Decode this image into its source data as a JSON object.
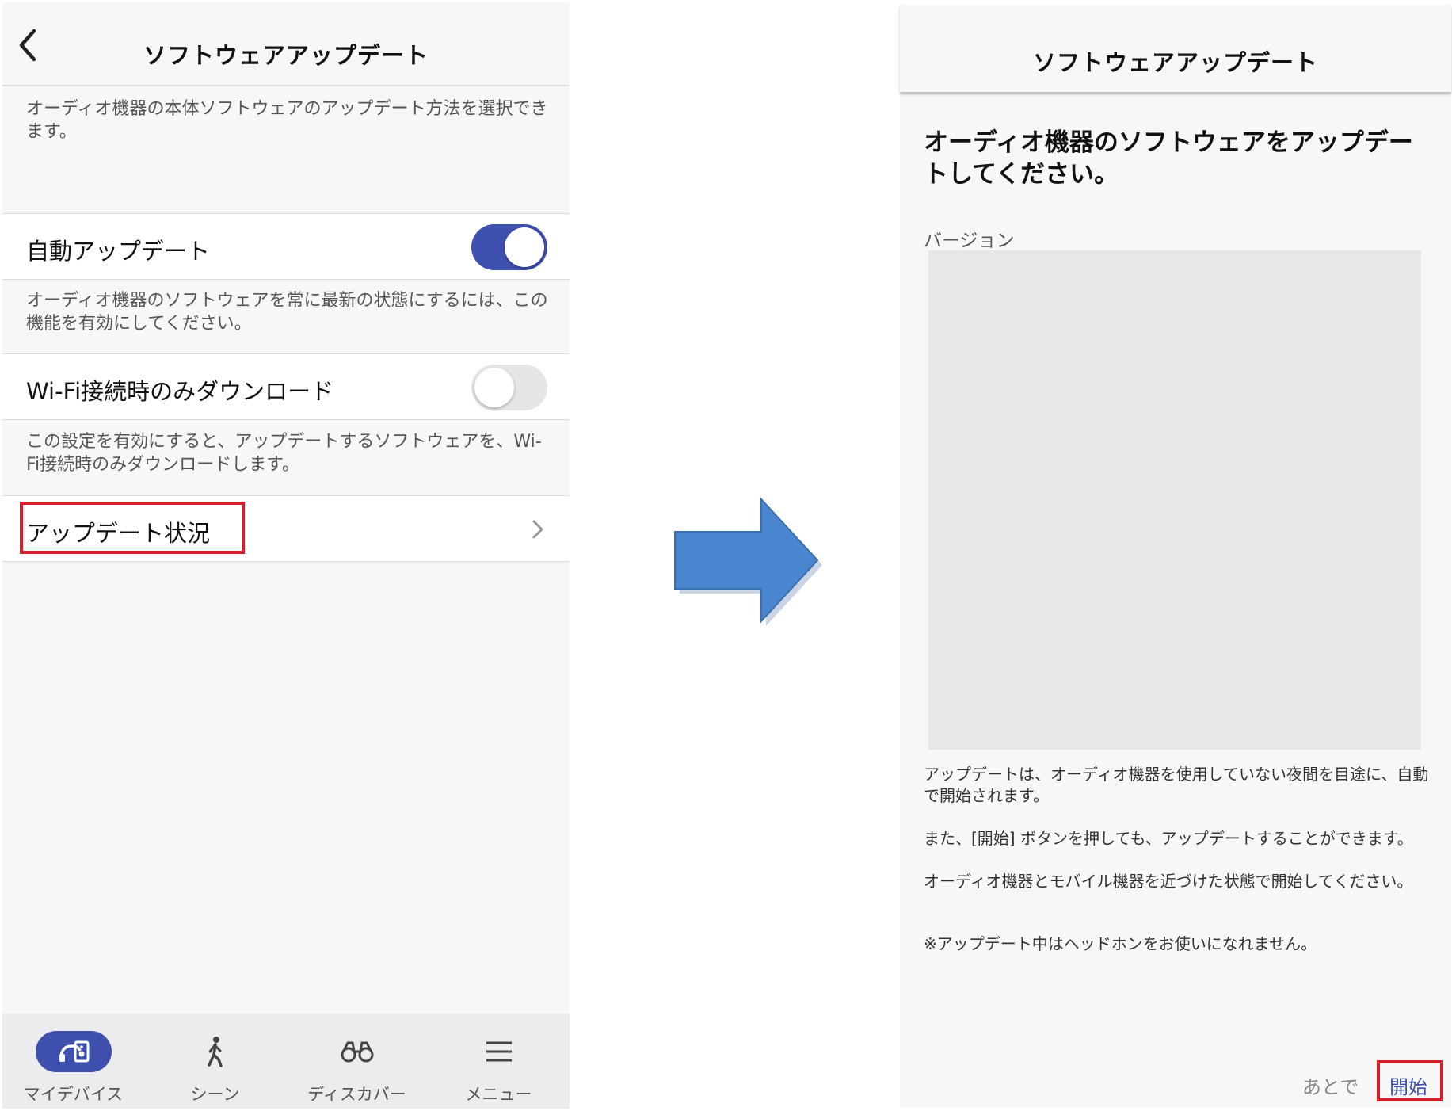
{
  "left": {
    "header": {
      "title": "ソフトウェアアップデート"
    },
    "intro": "オーディオ機器の本体ソフトウェアのアップデート方法を選択できます。",
    "auto_update": {
      "label": "自動アップデート",
      "enabled": true,
      "description": "オーディオ機器のソフトウェアを常に最新の状態にするには、この機能を有効にしてください。"
    },
    "wifi_only": {
      "label": "Wi-Fi接続時のみダウンロード",
      "enabled": false,
      "description": "この設定を有効にすると、アップデートするソフトウェアを、Wi-Fi接続時のみダウンロードします。"
    },
    "update_status": {
      "label": "アップデート状況"
    },
    "tabs": [
      {
        "label": "マイデバイス",
        "icon": "my-device-icon",
        "active": true
      },
      {
        "label": "シーン",
        "icon": "walking-person-icon",
        "active": false
      },
      {
        "label": "ディスカバー",
        "icon": "binoculars-icon",
        "active": false
      },
      {
        "label": "メニュー",
        "icon": "hamburger-menu-icon",
        "active": false
      }
    ]
  },
  "right": {
    "header": {
      "title": "ソフトウェアアップデート"
    },
    "heading": "オーディオ機器のソフトウェアをアップデートしてください。",
    "version_label": "バージョン",
    "paragraphs": [
      "アップデートは、オーディオ機器を使用していない夜間を目途に、自動で開始されます。",
      "また、[開始] ボタンを押しても、アップデートすることができます。",
      "オーディオ機器とモバイル機器を近づけた状態で開始してください。",
      "※アップデート中はヘッドホンをお使いになれません。"
    ],
    "buttons": {
      "later": "あとで",
      "start": "開始"
    }
  },
  "colors": {
    "accent": "#3e4fae",
    "highlight": "#d4202a",
    "arrow": "#4a86cf",
    "background": "#f7f7f8"
  }
}
